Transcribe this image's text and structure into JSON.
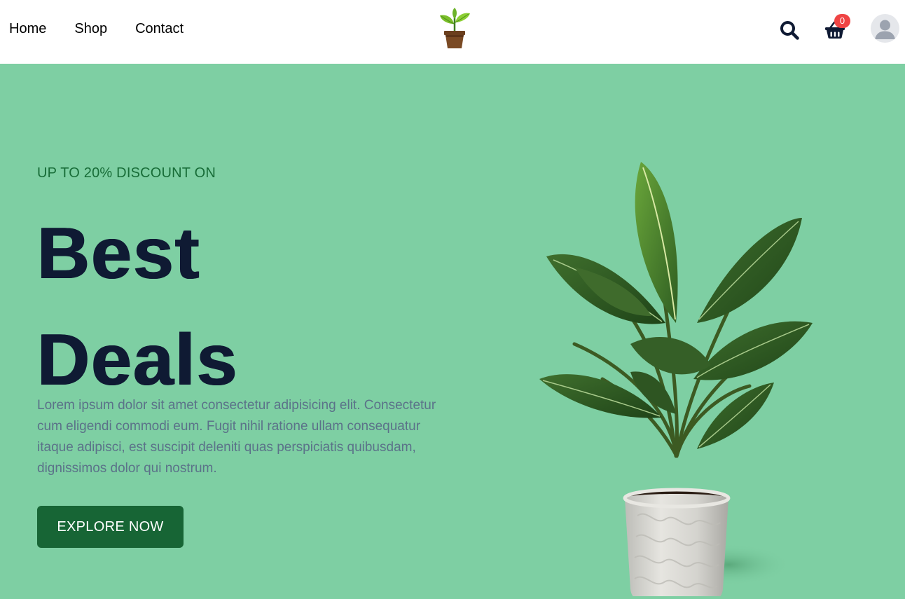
{
  "nav": {
    "home": "Home",
    "shop": "Shop",
    "contact": "Contact"
  },
  "header": {
    "logo_icon": "potted-sprout-icon",
    "search_icon": "search-icon",
    "cart_icon": "basket-icon",
    "cart_count": "0",
    "avatar_icon": "user-avatar-icon"
  },
  "hero": {
    "eyebrow": "UP TO 20% DISCOUNT ON",
    "title_line1": "Best",
    "title_line2": "Deals",
    "description": "Lorem ipsum dolor sit amet consectetur adipisicing elit. Consectetur cum eligendi commodi eum. Fugit nihil ratione ullam consequatur itaque adipisci, est suscipit deleniti quas perspiciatis quibusdam, dignissimos dolor qui nostrum.",
    "cta_label": "EXPLORE NOW",
    "image": "potted-plant-image"
  },
  "colors": {
    "hero_bg": "#7ecfa3",
    "accent": "#176535",
    "heading": "#0f1a33",
    "eyebrow": "#176c37",
    "body_text": "#5b7289",
    "badge": "#ef4444"
  }
}
